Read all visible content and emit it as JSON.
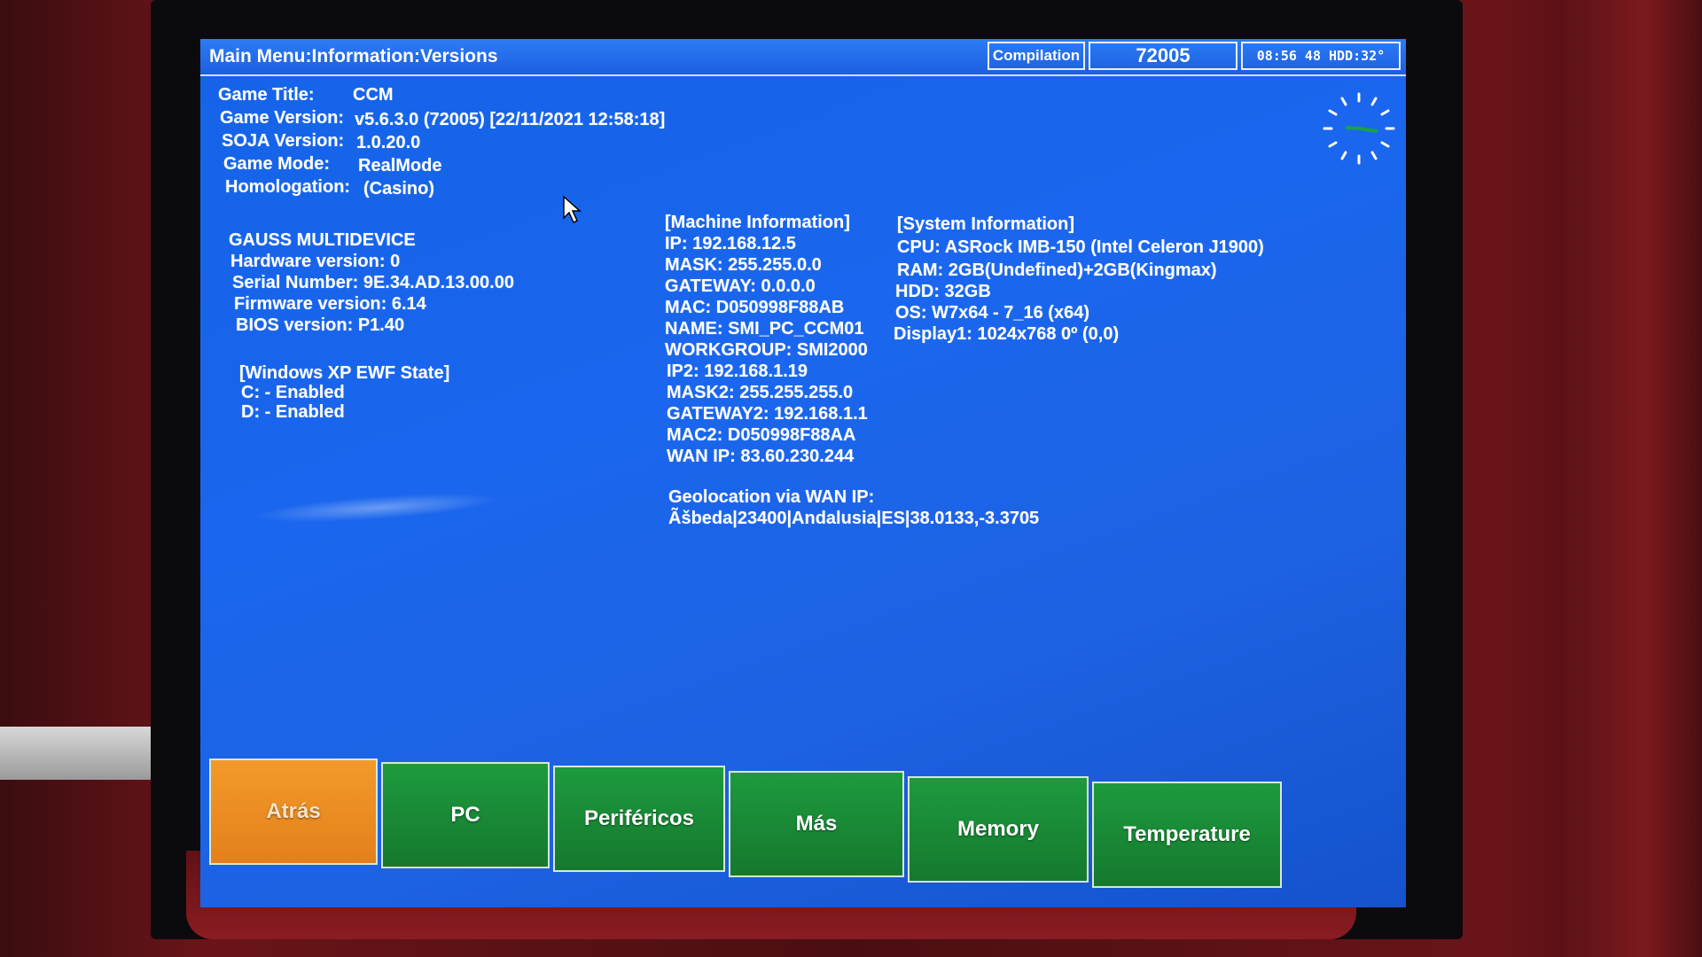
{
  "titlebar": {
    "path": "Main Menu:Information:Versions",
    "compilation_label": "Compilation",
    "compilation_number": "72005",
    "clock": "08:56 48 HDD:32°"
  },
  "game_info": {
    "title_label": "Game Title:",
    "title_value": "CCM",
    "version_label": "Game Version:",
    "version_value": "v5.6.3.0 (72005) [22/11/2021 12:58:18]",
    "soja_label": "SOJA Version:",
    "soja_value": "1.0.20.0",
    "mode_label": "Game Mode:",
    "mode_value": "RealMode",
    "homologation_label": "Homologation:",
    "homologation_value": "(Casino)"
  },
  "device_info": {
    "heading": "GAUSS MULTIDEVICE",
    "hardware": "Hardware version: 0",
    "serial": "Serial Number: 9E.34.AD.13.00.00",
    "firmware": "Firmware version: 6.14",
    "bios": "BIOS version: P1.40"
  },
  "ewf": {
    "heading": "[Windows XP EWF State]",
    "c_drive": "C: - Enabled",
    "d_drive": "D: - Enabled"
  },
  "machine_info": {
    "heading": "[Machine Information]",
    "lines": [
      "IP: 192.168.12.5",
      "MASK: 255.255.0.0",
      "GATEWAY: 0.0.0.0",
      "MAC: D050998F88AB",
      "NAME: SMI_PC_CCM01",
      "WORKGROUP: SMI2000",
      "IP2: 192.168.1.19",
      "MASK2: 255.255.255.0",
      "GATEWAY2: 192.168.1.1",
      "MAC2: D050998F88AA",
      "WAN IP: 83.60.230.244"
    ],
    "geo_label": "Geolocation via WAN IP:",
    "geo_value": "Ãšbeda|23400|Andalusia|ES|38.0133,-3.3705"
  },
  "system_info": {
    "heading": "[System Information]",
    "lines": [
      "CPU: ASRock IMB-150 (Intel Celeron J1900)",
      "RAM: 2GB(Undefined)+2GB(Kingmax)",
      "HDD: 32GB",
      "OS: W7x64 - 7_16 (x64)",
      "Display1: 1024x768 0º (0,0)"
    ]
  },
  "buttons": {
    "back": "Atrás",
    "pc": "PC",
    "peripherals": "Periféricos",
    "more": "Más",
    "memory": "Memory",
    "temperature": "Temperature"
  },
  "colors": {
    "screen_bg": "#1a66ee",
    "back_button": "#f29a2a",
    "nav_button": "#1e9a3e",
    "text": "#ffffff"
  }
}
